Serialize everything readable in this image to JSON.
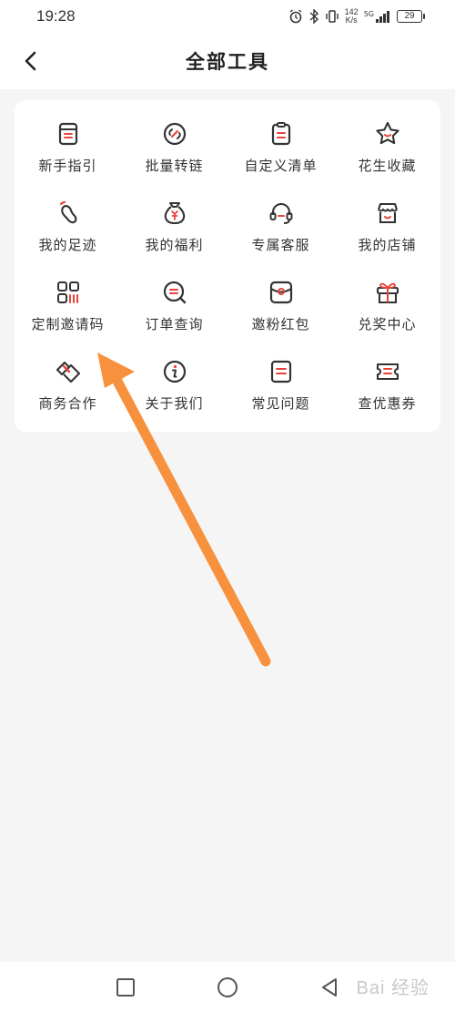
{
  "status_bar": {
    "time": "19:28",
    "net_speed_value": "142",
    "net_speed_unit": "K/s",
    "signal_label": "5G",
    "battery": "29"
  },
  "header": {
    "title": "全部工具"
  },
  "tools": [
    {
      "label": "新手指引",
      "icon": "guide-book-icon"
    },
    {
      "label": "批量转链",
      "icon": "link-convert-icon"
    },
    {
      "label": "自定义清单",
      "icon": "custom-list-icon"
    },
    {
      "label": "花生收藏",
      "icon": "star-icon"
    },
    {
      "label": "我的足迹",
      "icon": "footprint-icon"
    },
    {
      "label": "我的福利",
      "icon": "money-bag-icon"
    },
    {
      "label": "专属客服",
      "icon": "headset-icon"
    },
    {
      "label": "我的店铺",
      "icon": "shop-icon"
    },
    {
      "label": "定制邀请码",
      "icon": "qr-code-icon"
    },
    {
      "label": "订单查询",
      "icon": "order-search-icon"
    },
    {
      "label": "邀粉红包",
      "icon": "red-packet-icon"
    },
    {
      "label": "兑奖中心",
      "icon": "gift-icon"
    },
    {
      "label": "商务合作",
      "icon": "handshake-icon"
    },
    {
      "label": "关于我们",
      "icon": "info-icon"
    },
    {
      "label": "常见问题",
      "icon": "faq-icon"
    },
    {
      "label": "查优惠券",
      "icon": "coupon-icon"
    }
  ],
  "watermark": "Bai 经验",
  "colors": {
    "accent": "#e8433a",
    "icon_stroke": "#333333",
    "arrow": "#f7913d",
    "background": "#f5f5f5"
  }
}
